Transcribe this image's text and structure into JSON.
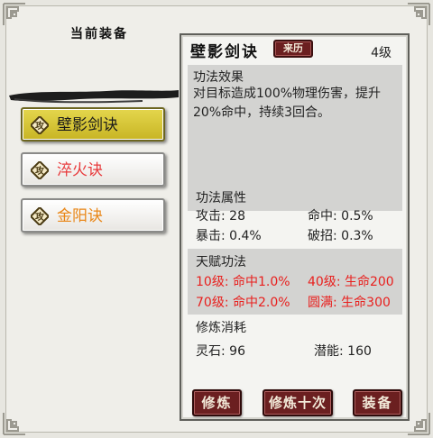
{
  "left_panel": {
    "title": "当前装备",
    "badge_text": "攻",
    "skills": [
      {
        "label": "壁影剑诀",
        "color": "#1a1a1a",
        "selected": true
      },
      {
        "label": "淬火诀",
        "color": "#e8393b",
        "selected": false
      },
      {
        "label": "金阳诀",
        "color": "#e98616",
        "selected": false
      }
    ]
  },
  "detail": {
    "name": "壁影剑诀",
    "origin_button": "来历",
    "level": "4级",
    "effect": {
      "title": "功法效果",
      "description": "对目标造成100%物理伤害，提升20%命中，持续3回合。"
    },
    "attributes": {
      "title": "功法属性",
      "attack": "攻击: 28",
      "hit": "命中: 0.5%",
      "crit": "暴击: 0.4%",
      "pierce": "破招: 0.3%"
    },
    "talent": {
      "title": "天赋功法",
      "t1": "10级: 命中1.0%",
      "t2": "40级: 生命200",
      "t3": "70级: 命中2.0%",
      "t4": "圆满: 生命300",
      "color": "#e8201e"
    },
    "cost": {
      "title": "修炼消耗",
      "spirit_stone": "灵石: 96",
      "potential": "潜能: 160"
    }
  },
  "buttons": {
    "train": "修炼",
    "train_ten": "修炼十次",
    "equip": "装备"
  }
}
